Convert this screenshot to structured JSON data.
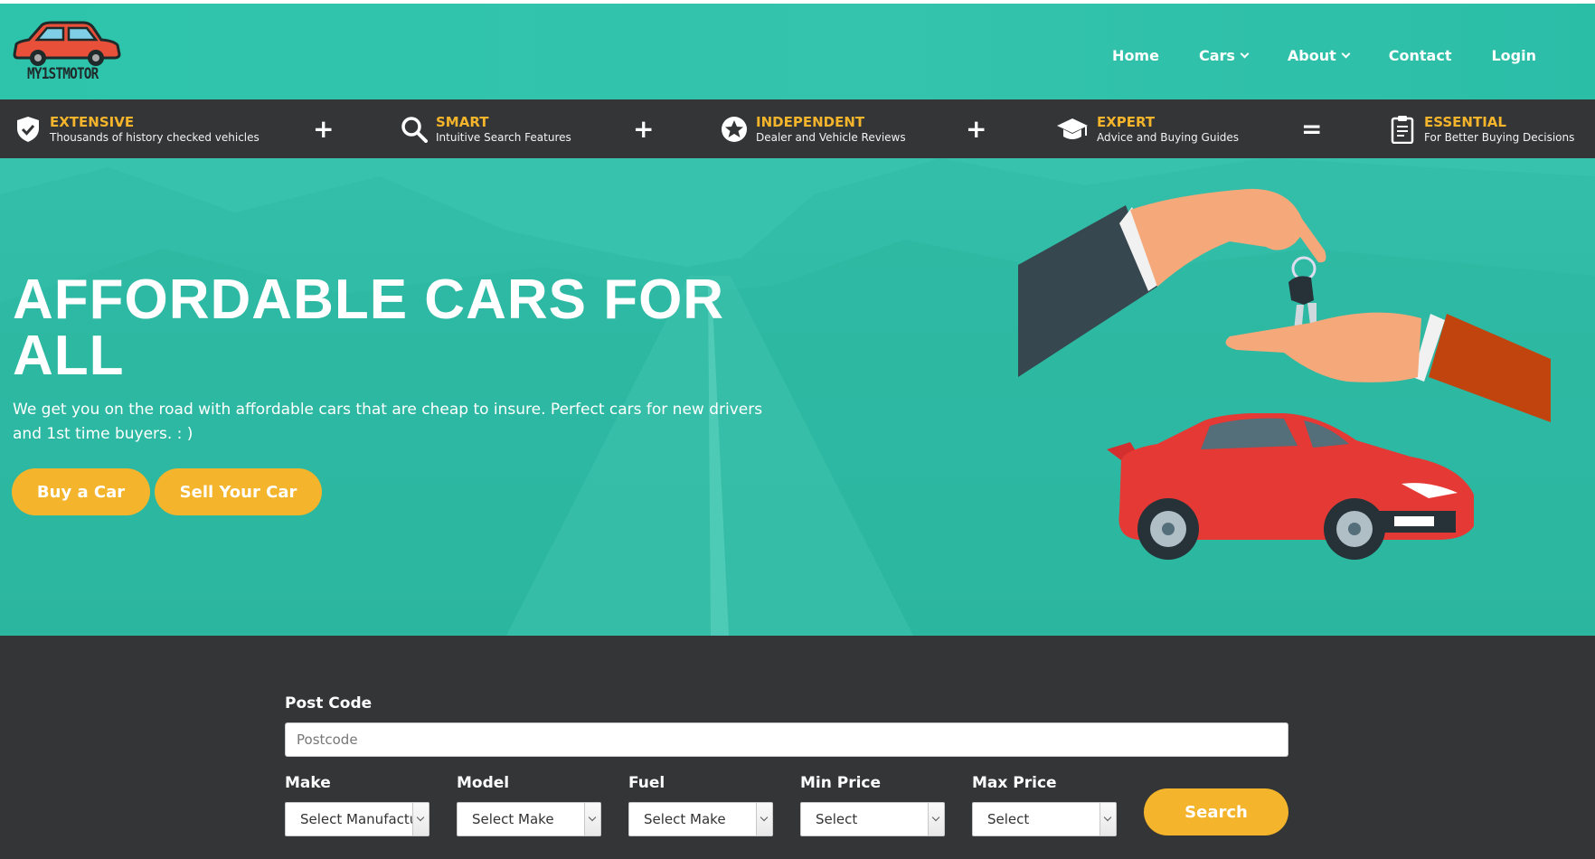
{
  "brand": {
    "logo_text": "MY1STMOTOR"
  },
  "nav": {
    "items": [
      {
        "label": "Home",
        "dropdown": false
      },
      {
        "label": "Cars",
        "dropdown": true
      },
      {
        "label": "About",
        "dropdown": true
      },
      {
        "label": "Contact",
        "dropdown": false
      },
      {
        "label": "Login",
        "dropdown": false
      }
    ]
  },
  "features": [
    {
      "icon": "shield-check-icon",
      "title": "EXTENSIVE",
      "subtitle": "Thousands of history checked vehicles"
    },
    {
      "icon": "search-icon",
      "title": "SMART",
      "subtitle": "Intuitive Search Features"
    },
    {
      "icon": "star-badge-icon",
      "title": "INDEPENDENT",
      "subtitle": "Dealer and Vehicle Reviews"
    },
    {
      "icon": "graduation-cap-icon",
      "title": "EXPERT",
      "subtitle": "Advice and Buying Guides"
    },
    {
      "icon": "clipboard-icon",
      "title": "ESSENTIAL",
      "subtitle": "For Better Buying Decisions"
    }
  ],
  "operators": [
    "+",
    "+",
    "+",
    "="
  ],
  "hero": {
    "title": "AFFORDABLE CARS FOR ALL",
    "subtitle": "We get you on the road with affordable cars that are cheap to insure. Perfect cars for new drivers and 1st time buyers. : )",
    "buy_label": "Buy a Car",
    "sell_label": "Sell Your Car"
  },
  "search": {
    "postcode_label": "Post Code",
    "postcode_placeholder": "Postcode",
    "make_label": "Make",
    "make_value": "Select Manufacturer",
    "model_label": "Model",
    "model_value": "Select Make",
    "fuel_label": "Fuel",
    "fuel_value": "Select Make",
    "min_label": "Min Price",
    "min_value": "Select",
    "max_label": "Max Price",
    "max_value": "Select",
    "search_label": "Search"
  },
  "colors": {
    "teal": "#2fbba5",
    "dark": "#343536",
    "accent": "#f4b42b"
  }
}
